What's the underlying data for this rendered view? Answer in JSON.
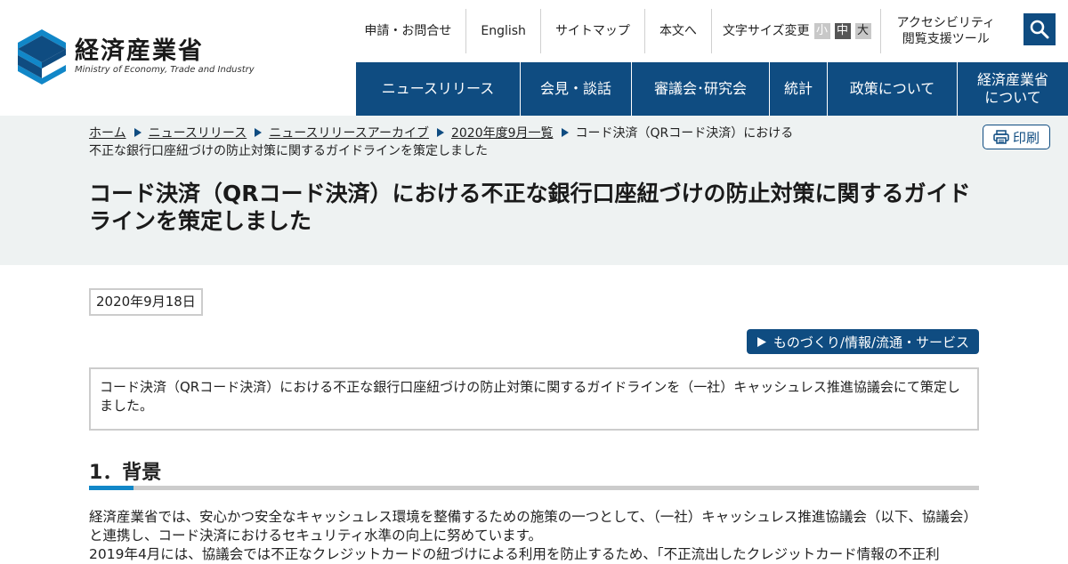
{
  "header": {
    "logo_jp": "経済産業省",
    "logo_en": "Ministry of Economy, Trade and Industry"
  },
  "utility_nav": {
    "contact": "申請・お問合せ",
    "english": "English",
    "sitemap": "サイトマップ",
    "skip": "本文へ",
    "font_size_label": "文字サイズ変更",
    "font_small": "小",
    "font_mid": "中",
    "font_large": "大",
    "accessibility_line1": "アクセシビリティ",
    "accessibility_line2": "閲覧支援ツール"
  },
  "main_nav": [
    {
      "label": "ニュースリリース"
    },
    {
      "label": "会見・談話"
    },
    {
      "label": "審議会･研究会"
    },
    {
      "label": "統計"
    },
    {
      "label": "政策について"
    },
    {
      "label_line1": "経済産業省",
      "label_line2": "について"
    }
  ],
  "breadcrumb": {
    "items": [
      "ホーム",
      "ニュースリリース",
      "ニュースリリースアーカイブ",
      "2020年度9月一覧"
    ],
    "current": "コード決済（QRコード決済）における不正な銀行口座紐づけの防止対策に関するガイドラインを策定しました"
  },
  "print_label": "印刷",
  "page_title": "コード決済（QRコード決済）における不正な銀行口座紐づけの防止対策に関するガイドラインを策定しました",
  "date": "2020年9月18日",
  "category": "ものづくり/情報/流通・サービス",
  "summary": "コード決済（QRコード決済）における不正な銀行口座紐づけの防止対策に関するガイドラインを（一社）キャッシュレス推進協議会にて策定しました。",
  "section1": {
    "heading": "1．背景",
    "body": "経済産業省では、安心かつ安全なキャッシュレス環境を整備するための施策の一つとして、（一社）キャッシュレス推進協議会（以下、協議会）と連携し、コード決済におけるセキュリティ水準の向上に努めています。",
    "body2": "2019年4月には、協議会では不正なクレジットカードの紐づけによる利用を防止するため、「不正流出したクレジットカード情報の不正利"
  },
  "colors": {
    "brand": "#0f4c81",
    "accent": "#1187c8",
    "band": "#eef2f2"
  }
}
